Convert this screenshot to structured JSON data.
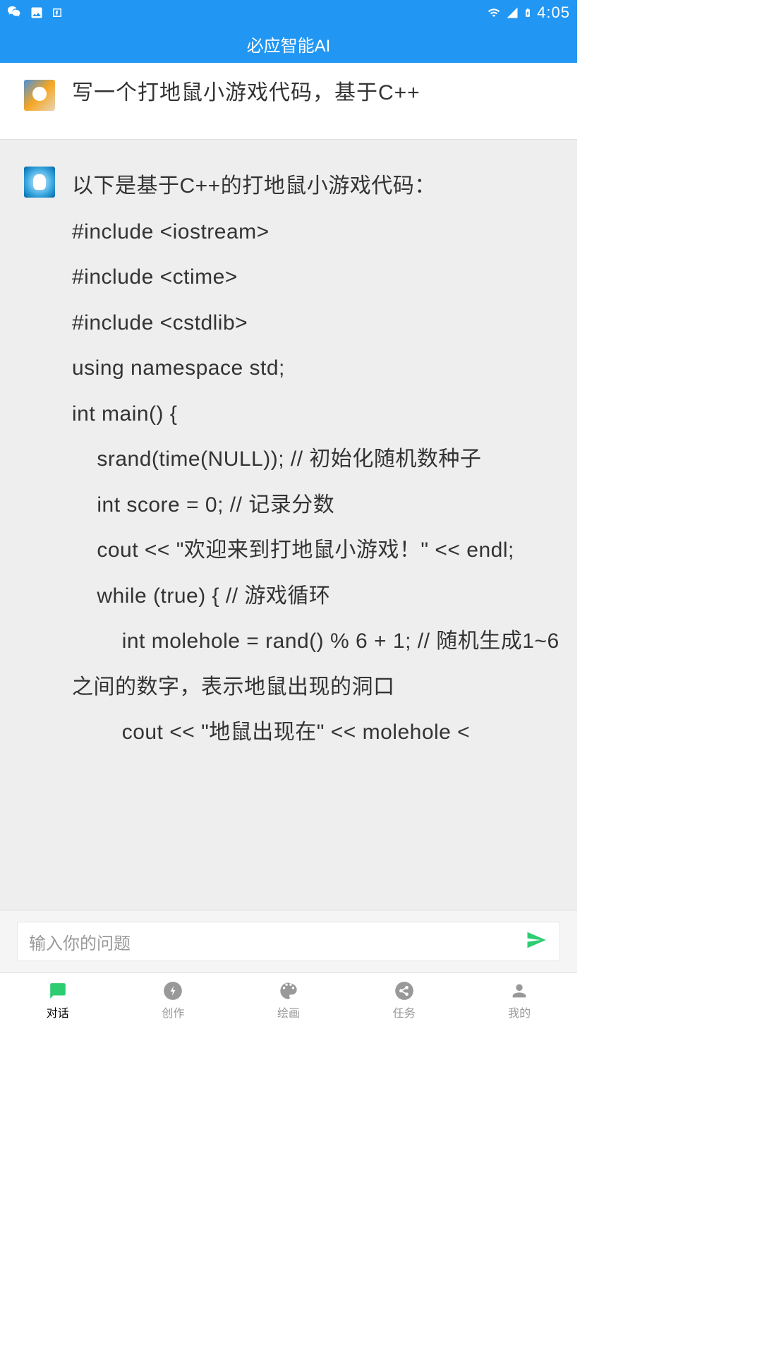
{
  "status": {
    "time": "4:05"
  },
  "header": {
    "title": "必应智能AI"
  },
  "chat": {
    "user_message": "写一个打地鼠小游戏代码，基于C++",
    "ai_message": "以下是基于C++的打地鼠小游戏代码：\n#include <iostream>\n#include <ctime>\n#include <cstdlib>\nusing namespace std;\nint main() {\n    srand(time(NULL)); // 初始化随机数种子\n    int score = 0; // 记录分数\n    cout << \"欢迎来到打地鼠小游戏！\" << endl;\n    while (true) { // 游戏循环\n        int molehole = rand() % 6 + 1; // 随机生成1~6之间的数字，表示地鼠出现的洞口\n        cout << \"地鼠出现在\" << molehole <"
  },
  "input": {
    "placeholder": "输入你的问题"
  },
  "nav": {
    "items": [
      {
        "label": "对话"
      },
      {
        "label": "创作"
      },
      {
        "label": "绘画"
      },
      {
        "label": "任务"
      },
      {
        "label": "我的"
      }
    ]
  }
}
